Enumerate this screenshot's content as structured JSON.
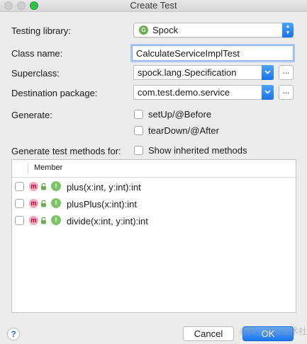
{
  "window": {
    "title": "Create Test"
  },
  "form": {
    "testing_library_label": "Testing library:",
    "testing_library_value": "Spock",
    "testing_library_badge": "G",
    "class_name_label": "Class name:",
    "class_name_value": "CalculateServiceImplTest",
    "superclass_label": "Superclass:",
    "superclass_value": "spock.lang.Specification",
    "destination_label": "Destination package:",
    "destination_value": "com.test.demo.service",
    "ellipsis": "...",
    "generate_label": "Generate:",
    "generate_options": [
      "setUp/@Before",
      "tearDown/@After"
    ],
    "generate_methods_label": "Generate test methods for:",
    "show_inherited_label": "Show inherited methods"
  },
  "table": {
    "header": "Member",
    "row_icon_letter": "m",
    "row_icon_i": "I",
    "rows": [
      "plus(x:int, y:int):int",
      "plusPlus(x:int):int",
      "divide(x:int, y:int):int"
    ]
  },
  "footer": {
    "help": "?",
    "cancel": "Cancel",
    "ok": "OK"
  },
  "watermark": "@稀土掘金技术社区",
  "colors": {
    "accent": "#1a73e8",
    "spock_badge": "#6ab04c",
    "method_icon": "#f2a7b6",
    "interface_icon": "#7cc36a"
  }
}
